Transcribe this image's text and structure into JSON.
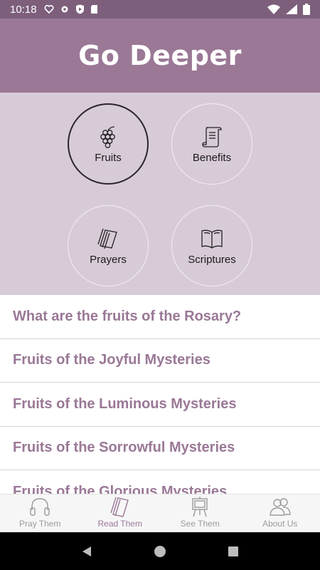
{
  "status_bar": {
    "time": "10:18"
  },
  "header": {
    "title": "Go Deeper"
  },
  "categories": [
    {
      "label": "Fruits",
      "icon": "grapes-icon",
      "active": true
    },
    {
      "label": "Benefits",
      "icon": "scroll-icon",
      "active": false
    },
    {
      "label": "Prayers",
      "icon": "prayer-booklet-icon",
      "active": false
    },
    {
      "label": "Scriptures",
      "icon": "open-book-icon",
      "active": false
    }
  ],
  "list": {
    "items": [
      "What are the fruits of the Rosary?",
      "Fruits of the Joyful Mysteries",
      "Fruits of the Luminous Mysteries",
      "Fruits of the Sorrowful Mysteries",
      "Fruits of the Glorious Mysteries"
    ]
  },
  "tabs": [
    {
      "label": "Pray Them",
      "icon": "headphones-icon",
      "active": false
    },
    {
      "label": "Read Them",
      "icon": "booklet-icon",
      "active": true
    },
    {
      "label": "See Them",
      "icon": "easel-icon",
      "active": false
    },
    {
      "label": "About Us",
      "icon": "people-icon",
      "active": false
    }
  ],
  "colors": {
    "header": "#9a7896",
    "status_bar": "#7d5f7c",
    "panel": "#d8cbd8",
    "accent_text": "#9a7896"
  }
}
